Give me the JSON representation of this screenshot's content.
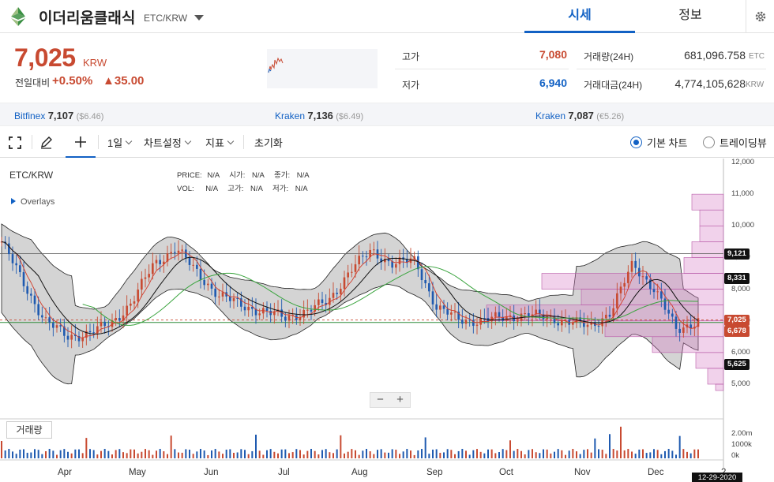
{
  "header": {
    "coin_name": "이더리움클래식",
    "pair": "ETC/KRW",
    "tabs": [
      {
        "label": "시세",
        "active": true
      },
      {
        "label": "정보",
        "active": false
      }
    ],
    "accent": "#1261c4"
  },
  "price": {
    "current": "7,025",
    "unit": "KRW",
    "change_label": "전일대비",
    "change_pct": "+0.50%",
    "change_abs": "▲35.00",
    "up_color": "#c84a31",
    "down_color": "#1261c4"
  },
  "stats": {
    "high_label": "고가",
    "high_value": "7,080",
    "low_label": "저가",
    "low_value": "6,940",
    "volume_label": "거래량(24H)",
    "volume_value": "681,096.758",
    "volume_unit": "ETC",
    "trade_amount_label": "거래대금(24H)",
    "trade_amount_value": "4,774,105,628",
    "trade_amount_unit": "KRW"
  },
  "exchanges": [
    {
      "name": "Bitfinex",
      "price": "7,107",
      "sub": "($6.46)"
    },
    {
      "name": "Kraken",
      "price": "7,136",
      "sub": "($6.49)"
    },
    {
      "name": "Kraken",
      "price": "7,087",
      "sub": "(€5.26)"
    }
  ],
  "toolbar": {
    "interval": "1일",
    "chart_settings": "차트설정",
    "indicators": "지표",
    "reset": "초기화",
    "basic_chart": "기본 차트",
    "tradingview": "트레이딩뷰"
  },
  "chart": {
    "symbol": "ETC/KRW",
    "legend_row1": [
      {
        "label": "PRICE:",
        "value": "N/A"
      },
      {
        "label": "시가:",
        "value": "N/A"
      },
      {
        "label": "종가:",
        "value": "N/A"
      }
    ],
    "legend_row2": [
      {
        "label": "VOL:",
        "value": "N/A"
      },
      {
        "label": "고가:",
        "value": "N/A"
      },
      {
        "label": "저가:",
        "value": "N/A"
      }
    ],
    "overlays_label": "Overlays",
    "volume_label": "거래량",
    "zoom_minus": "−",
    "zoom_plus": "+",
    "y_ticks": [
      "12,000",
      "11,000",
      "10,000",
      "9,000",
      "8,000",
      "7,000",
      "6,000",
      "5,000"
    ],
    "volume_ticks": [
      "2.00m",
      "1000k",
      "0k"
    ],
    "x_labels": [
      "Apr",
      "May",
      "Jun",
      "Jul",
      "Aug",
      "Sep",
      "Oct",
      "Nov",
      "Dec"
    ],
    "x_label_cut": "2",
    "price_tags": [
      {
        "value": "9,121",
        "color": "#111111"
      },
      {
        "value": "8,331",
        "color": "#111111"
      },
      {
        "value": "7,025",
        "color": "#c84a31"
      },
      {
        "value": "6,678",
        "color": "#c84a31"
      },
      {
        "value": "5,625",
        "color": "#111111"
      }
    ],
    "cursor_date": "12-29-2020"
  },
  "chart_data": {
    "type": "candlestick",
    "y_axis": {
      "min": 5000,
      "max": 12000,
      "ticks": [
        5000,
        6000,
        7000,
        8000,
        9000,
        10000,
        11000,
        12000
      ]
    },
    "x_months": [
      "Apr",
      "May",
      "Jun",
      "Jul",
      "Aug",
      "Sep",
      "Oct",
      "Nov",
      "Dec"
    ],
    "close_approx": [
      9500,
      8200,
      7000,
      6500,
      6600,
      6900,
      7600,
      8800,
      9300,
      8500,
      7800,
      7500,
      7300,
      7100,
      7300,
      7600,
      8600,
      9200,
      8800,
      8900,
      7400,
      7050,
      7000,
      7100,
      7200,
      7100,
      7000,
      6800,
      7300,
      8800,
      8000,
      6700,
      7025
    ],
    "bollinger": true,
    "moving_averages": [
      "red",
      "black",
      "green"
    ],
    "horizontal_levels": [
      9121,
      7025
    ],
    "volume_profile": true
  }
}
